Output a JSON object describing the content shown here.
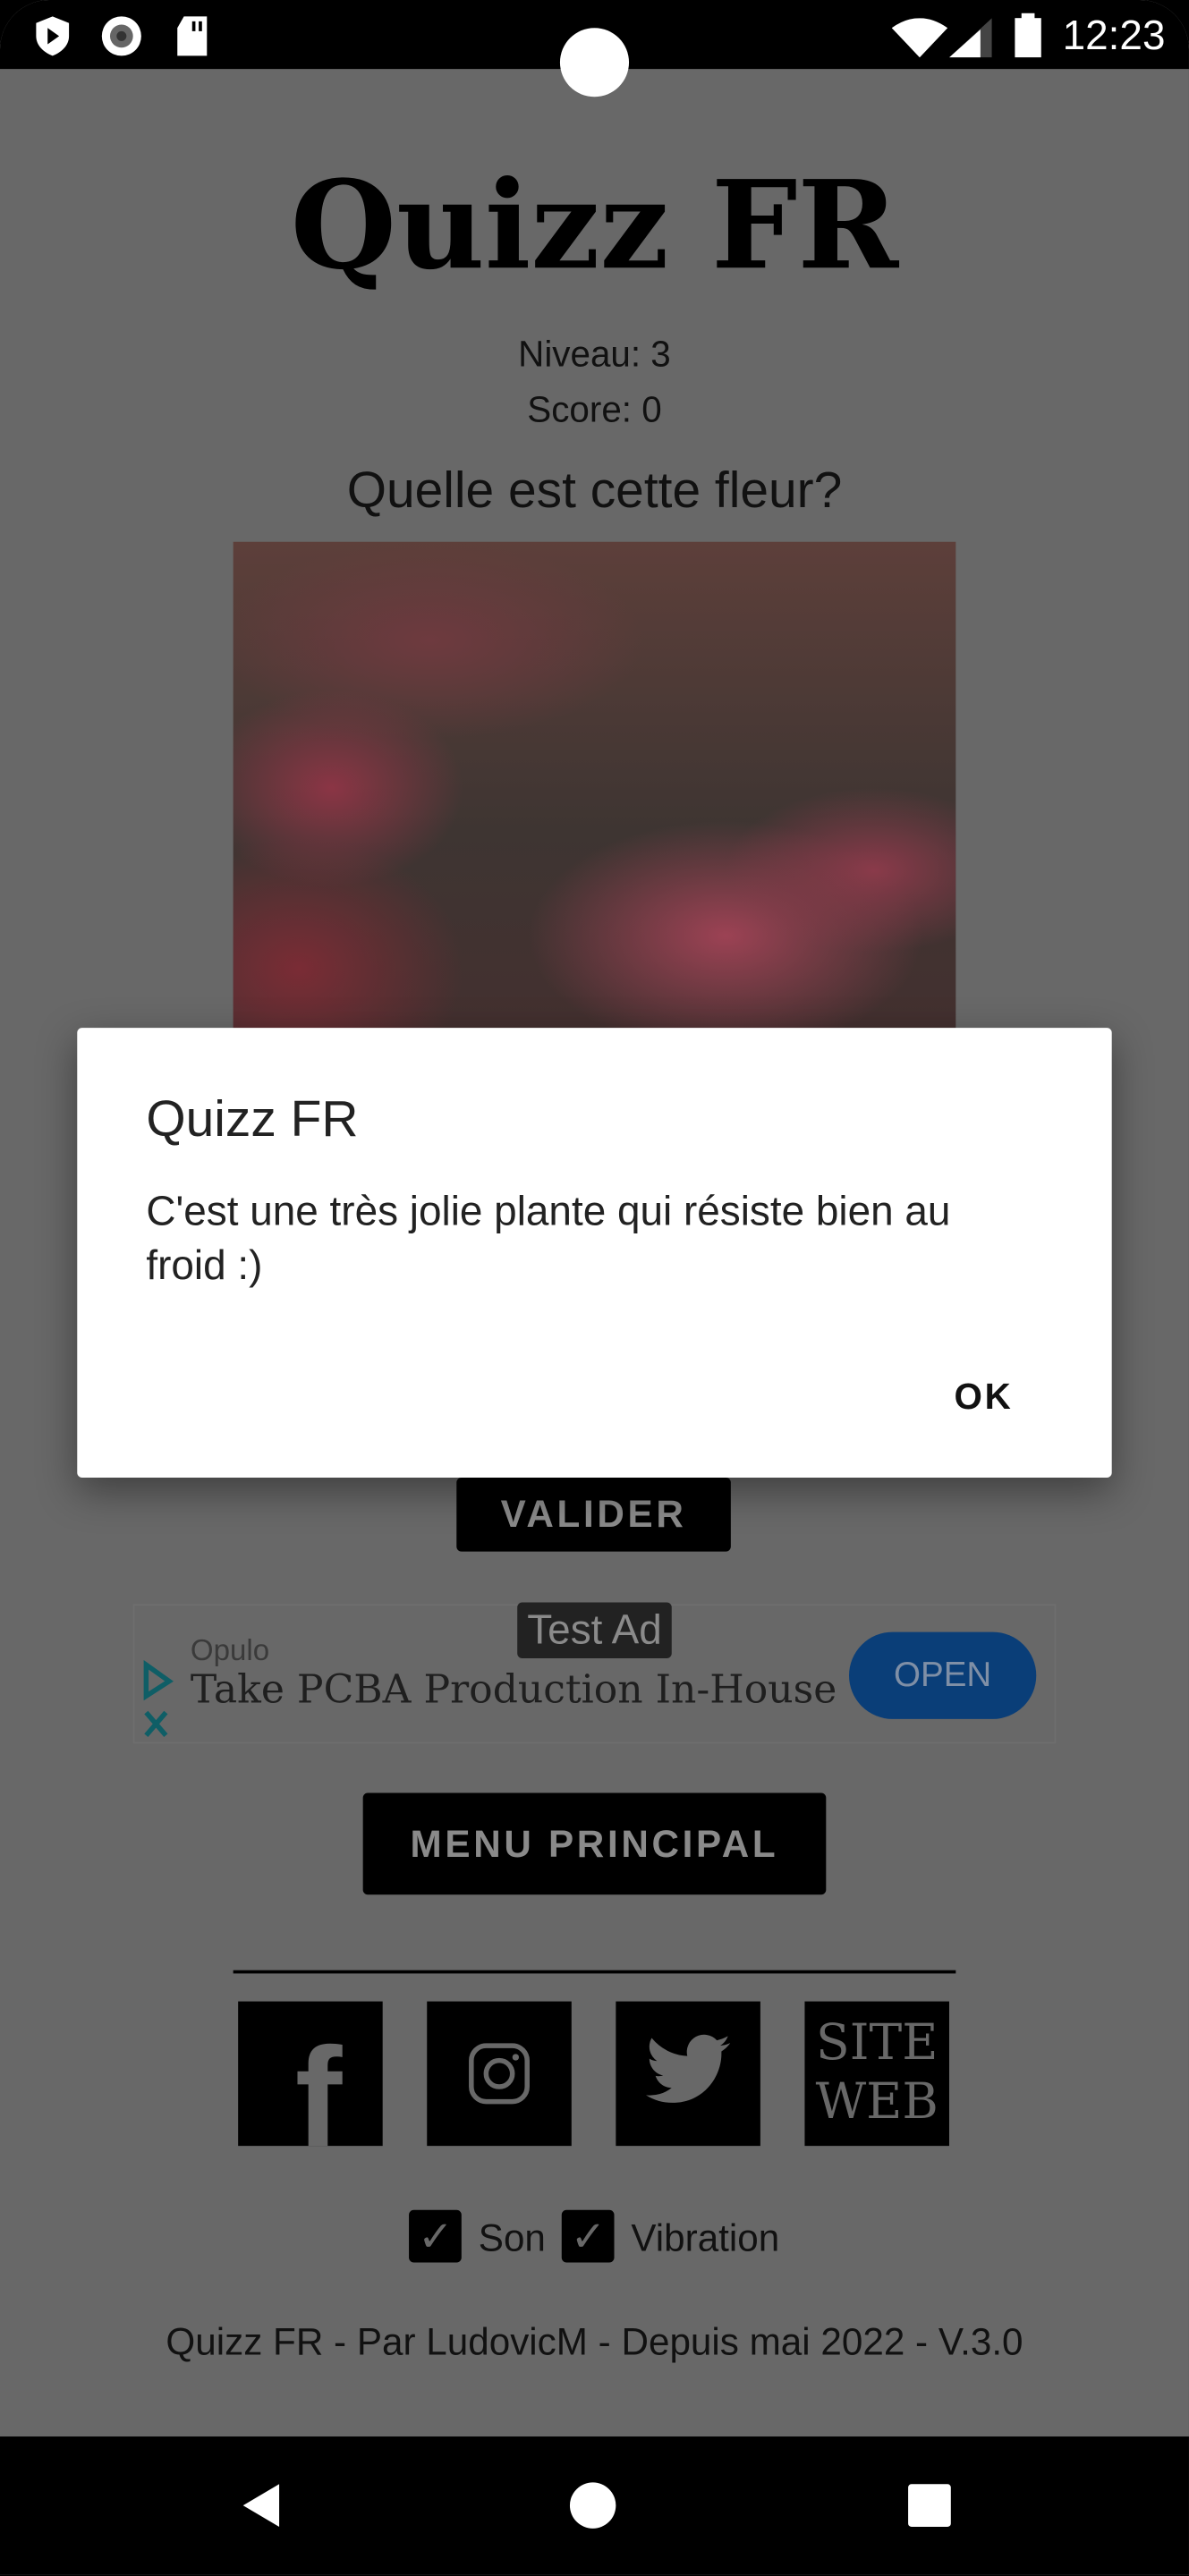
{
  "status_bar": {
    "time": "12:23",
    "left_icons": [
      "play-protect-icon",
      "record-icon",
      "sd-card-icon"
    ],
    "right_icons": [
      "wifi-icon",
      "signal-icon",
      "battery-icon"
    ]
  },
  "app": {
    "title": "Quizz FR",
    "level": "Niveau: 3",
    "score": "Score: 0",
    "question": "Quelle est cette fleur?",
    "image": "flower-photo"
  },
  "dialog": {
    "title": "Quizz FR",
    "message": "C'est une très jolie plante qui résiste bien au froid :)",
    "ok_label": "OK"
  },
  "buttons": {
    "validate": "VALIDER",
    "main_menu": "MENU PRINCIPAL"
  },
  "ad": {
    "badge": "Test Ad",
    "advertiser": "Opulo",
    "headline": "Take PCBA Production In-House",
    "cta": "OPEN",
    "accent": "#0a3e78"
  },
  "social": {
    "facebook": "f",
    "website": [
      "SITE",
      "WEB"
    ]
  },
  "settings": {
    "sound": "Son",
    "vibration": "Vibration",
    "sound_checked": true,
    "vibration_checked": true
  },
  "footer": "Quizz FR - Par LudovicM - Depuis mai 2022 - V.3.0",
  "colors": {
    "scrim": "#686868",
    "dialog": "#ffffff",
    "button": "#000000"
  }
}
